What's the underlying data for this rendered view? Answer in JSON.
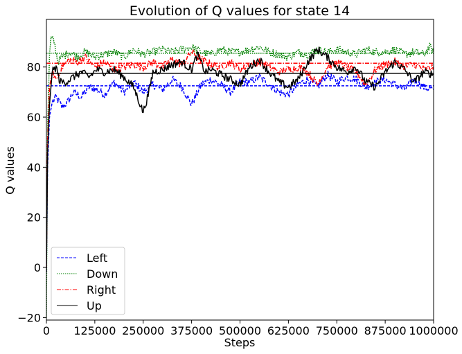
{
  "chart_data": {
    "type": "line",
    "title": "Evolution of Q values for state 14",
    "xlabel": "Steps",
    "ylabel": "Q values",
    "xlim": [
      0,
      1000000
    ],
    "ylim": [
      -21,
      99
    ],
    "xticks": [
      0,
      125000,
      250000,
      375000,
      500000,
      625000,
      750000,
      875000,
      1000000
    ],
    "yticks": [
      -20,
      0,
      20,
      40,
      60,
      80
    ],
    "grid": false,
    "legend_position": "lower left",
    "series": [
      {
        "name": "Left",
        "color": "#0000ff",
        "linestyle": "dashed",
        "reference_value": 72.5,
        "points": [
          [
            0,
            -2
          ],
          [
            3000,
            40
          ],
          [
            8000,
            60
          ],
          [
            15000,
            66
          ],
          [
            25000,
            68
          ],
          [
            40000,
            64
          ],
          [
            55000,
            66
          ],
          [
            70000,
            70
          ],
          [
            90000,
            68
          ],
          [
            110000,
            72
          ],
          [
            130000,
            71
          ],
          [
            150000,
            69
          ],
          [
            175000,
            74
          ],
          [
            200000,
            70
          ],
          [
            225000,
            74
          ],
          [
            250000,
            70
          ],
          [
            275000,
            73
          ],
          [
            300000,
            71
          ],
          [
            325000,
            75
          ],
          [
            350000,
            72
          ],
          [
            375000,
            65
          ],
          [
            400000,
            73
          ],
          [
            425000,
            75
          ],
          [
            450000,
            73
          ],
          [
            475000,
            70
          ],
          [
            500000,
            74
          ],
          [
            525000,
            74
          ],
          [
            550000,
            76
          ],
          [
            575000,
            73
          ],
          [
            600000,
            70
          ],
          [
            625000,
            69
          ],
          [
            650000,
            73
          ],
          [
            675000,
            75
          ],
          [
            700000,
            72
          ],
          [
            725000,
            77
          ],
          [
            750000,
            74
          ],
          [
            775000,
            76
          ],
          [
            800000,
            75
          ],
          [
            825000,
            72
          ],
          [
            850000,
            74
          ],
          [
            875000,
            75
          ],
          [
            900000,
            73
          ],
          [
            925000,
            71
          ],
          [
            950000,
            75
          ],
          [
            975000,
            72
          ],
          [
            1000000,
            71
          ]
        ]
      },
      {
        "name": "Down",
        "color": "#008000",
        "linestyle": "dotted",
        "reference_value": 85.5,
        "points": [
          [
            0,
            -20
          ],
          [
            3000,
            55
          ],
          [
            8000,
            85
          ],
          [
            12000,
            92
          ],
          [
            20000,
            90
          ],
          [
            30000,
            82
          ],
          [
            40000,
            84
          ],
          [
            60000,
            86
          ],
          [
            80000,
            84
          ],
          [
            100000,
            86
          ],
          [
            125000,
            84
          ],
          [
            150000,
            85
          ],
          [
            175000,
            86
          ],
          [
            200000,
            84
          ],
          [
            225000,
            87
          ],
          [
            250000,
            85
          ],
          [
            275000,
            86
          ],
          [
            300000,
            87
          ],
          [
            325000,
            86
          ],
          [
            350000,
            87
          ],
          [
            375000,
            88
          ],
          [
            400000,
            86
          ],
          [
            425000,
            85
          ],
          [
            450000,
            87
          ],
          [
            475000,
            86
          ],
          [
            500000,
            86
          ],
          [
            525000,
            87
          ],
          [
            550000,
            88
          ],
          [
            575000,
            86
          ],
          [
            600000,
            85
          ],
          [
            625000,
            84
          ],
          [
            650000,
            86
          ],
          [
            675000,
            85
          ],
          [
            700000,
            87
          ],
          [
            725000,
            86
          ],
          [
            750000,
            87
          ],
          [
            775000,
            86
          ],
          [
            800000,
            85
          ],
          [
            825000,
            87
          ],
          [
            850000,
            86
          ],
          [
            875000,
            86
          ],
          [
            900000,
            87
          ],
          [
            925000,
            85
          ],
          [
            950000,
            86
          ],
          [
            975000,
            85
          ],
          [
            990000,
            88
          ],
          [
            1000000,
            86
          ]
        ]
      },
      {
        "name": "Right",
        "color": "#ff0000",
        "linestyle": "dashdot",
        "reference_value": 81.5,
        "points": [
          [
            0,
            0
          ],
          [
            3000,
            50
          ],
          [
            8000,
            72
          ],
          [
            15000,
            78
          ],
          [
            25000,
            75
          ],
          [
            40000,
            80
          ],
          [
            60000,
            83
          ],
          [
            80000,
            82
          ],
          [
            100000,
            84
          ],
          [
            125000,
            80
          ],
          [
            150000,
            82
          ],
          [
            175000,
            79
          ],
          [
            200000,
            80
          ],
          [
            225000,
            81
          ],
          [
            250000,
            80
          ],
          [
            275000,
            82
          ],
          [
            300000,
            80
          ],
          [
            325000,
            83
          ],
          [
            350000,
            81
          ],
          [
            375000,
            86
          ],
          [
            400000,
            83
          ],
          [
            425000,
            81
          ],
          [
            450000,
            80
          ],
          [
            475000,
            82
          ],
          [
            500000,
            79
          ],
          [
            525000,
            81
          ],
          [
            550000,
            82
          ],
          [
            575000,
            80
          ],
          [
            600000,
            78
          ],
          [
            625000,
            79
          ],
          [
            650000,
            80
          ],
          [
            675000,
            78
          ],
          [
            700000,
            73
          ],
          [
            725000,
            80
          ],
          [
            750000,
            82
          ],
          [
            775000,
            80
          ],
          [
            800000,
            78
          ],
          [
            825000,
            73
          ],
          [
            850000,
            79
          ],
          [
            875000,
            81
          ],
          [
            900000,
            82
          ],
          [
            925000,
            80
          ],
          [
            950000,
            81
          ],
          [
            975000,
            79
          ],
          [
            1000000,
            80
          ]
        ]
      },
      {
        "name": "Up",
        "color": "#000000",
        "linestyle": "solid",
        "reference_value": 77.5,
        "points": [
          [
            0,
            -2
          ],
          [
            3000,
            45
          ],
          [
            8000,
            65
          ],
          [
            15000,
            78
          ],
          [
            25000,
            80
          ],
          [
            35000,
            74
          ],
          [
            50000,
            74
          ],
          [
            70000,
            76
          ],
          [
            90000,
            78
          ],
          [
            110000,
            76
          ],
          [
            130000,
            79
          ],
          [
            150000,
            78
          ],
          [
            175000,
            79
          ],
          [
            200000,
            76
          ],
          [
            225000,
            72
          ],
          [
            250000,
            62
          ],
          [
            265000,
            70
          ],
          [
            275000,
            78
          ],
          [
            300000,
            79
          ],
          [
            325000,
            81
          ],
          [
            350000,
            82
          ],
          [
            375000,
            79
          ],
          [
            390000,
            85
          ],
          [
            410000,
            78
          ],
          [
            425000,
            79
          ],
          [
            450000,
            77
          ],
          [
            475000,
            75
          ],
          [
            500000,
            73
          ],
          [
            525000,
            80
          ],
          [
            550000,
            83
          ],
          [
            575000,
            78
          ],
          [
            600000,
            74
          ],
          [
            625000,
            72
          ],
          [
            650000,
            75
          ],
          [
            675000,
            82
          ],
          [
            700000,
            87
          ],
          [
            725000,
            84
          ],
          [
            750000,
            80
          ],
          [
            775000,
            78
          ],
          [
            800000,
            80
          ],
          [
            825000,
            74
          ],
          [
            850000,
            72
          ],
          [
            875000,
            78
          ],
          [
            900000,
            82
          ],
          [
            925000,
            79
          ],
          [
            950000,
            74
          ],
          [
            975000,
            78
          ],
          [
            1000000,
            77
          ]
        ]
      }
    ]
  }
}
